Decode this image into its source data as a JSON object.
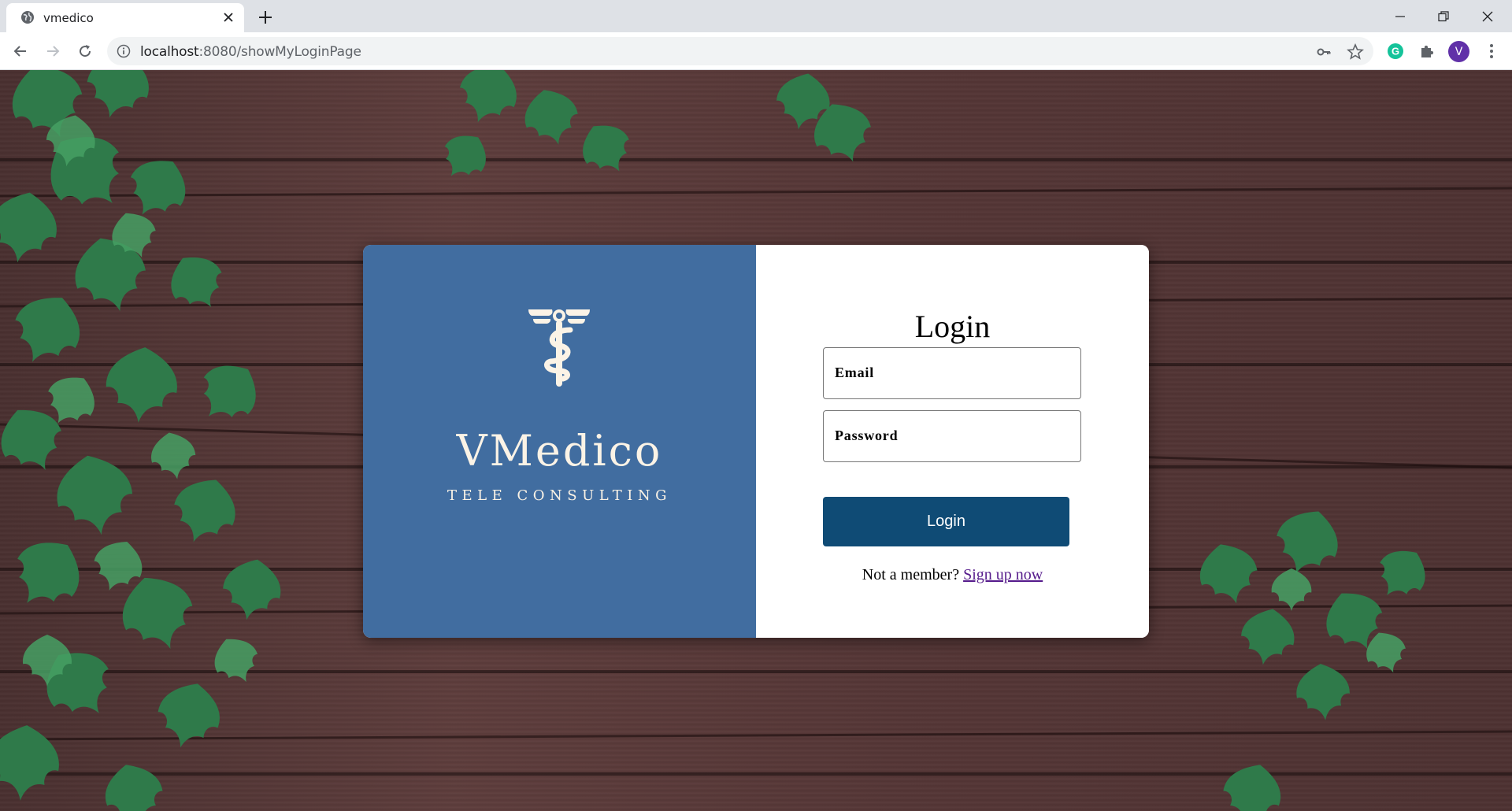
{
  "browser": {
    "tab_title": "vmedico",
    "url_host": "localhost",
    "url_path": ":8080/showMyLoginPage",
    "profile_initial": "V"
  },
  "brand": {
    "name": "VMedico",
    "tagline": "TELE CONSULTING",
    "color": "#416da0"
  },
  "login": {
    "title": "Login",
    "email_placeholder": "Email",
    "password_placeholder": "Password",
    "button_label": "Login",
    "signup_prompt": "Not a member?",
    "signup_link": "Sign up now",
    "button_color": "#0f4b75"
  }
}
